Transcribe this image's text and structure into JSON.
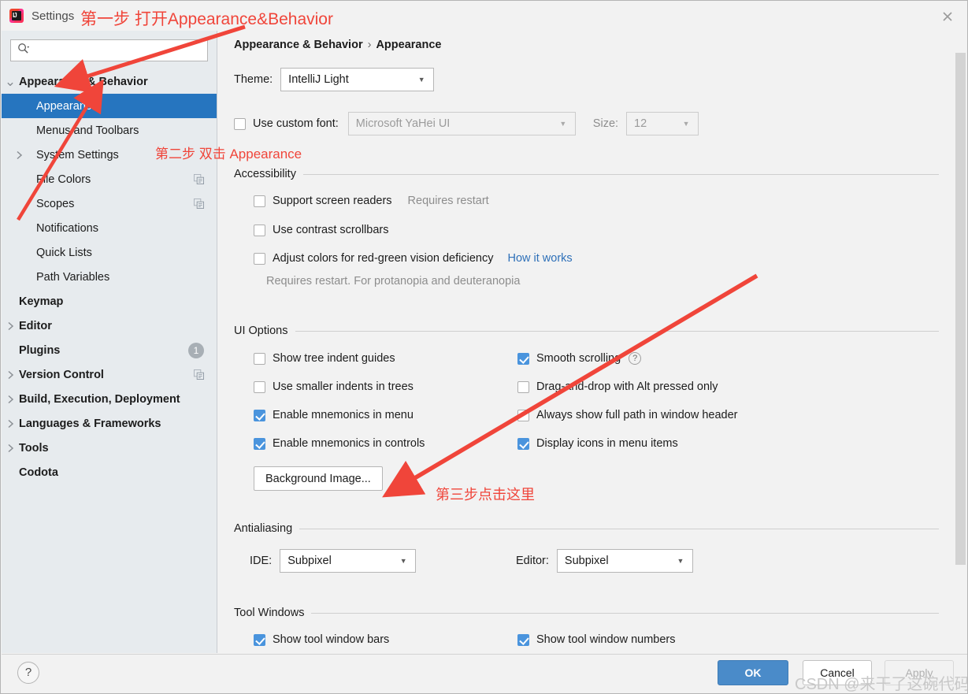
{
  "window": {
    "title": "Settings",
    "app_icon": "intellij-idea-icon",
    "close_icon": "close-icon"
  },
  "sidebar": {
    "search": {
      "placeholder": "",
      "value": "",
      "icon": "search-icon"
    },
    "items": [
      {
        "label": "Appearance & Behavior",
        "level": 0,
        "chevron": "chevron-down-icon",
        "selected": false,
        "tail": ""
      },
      {
        "label": "Appearance",
        "level": 1,
        "chevron": "",
        "selected": true,
        "tail": ""
      },
      {
        "label": "Menus and Toolbars",
        "level": 1,
        "chevron": "",
        "selected": false,
        "tail": ""
      },
      {
        "label": "System Settings",
        "level": 1,
        "chevron": "chevron-right-icon",
        "selected": false,
        "tail": ""
      },
      {
        "label": "File Colors",
        "level": 1,
        "chevron": "",
        "selected": false,
        "tail": "copy-icon"
      },
      {
        "label": "Scopes",
        "level": 1,
        "chevron": "",
        "selected": false,
        "tail": "copy-icon"
      },
      {
        "label": "Notifications",
        "level": 1,
        "chevron": "",
        "selected": false,
        "tail": ""
      },
      {
        "label": "Quick Lists",
        "level": 1,
        "chevron": "",
        "selected": false,
        "tail": ""
      },
      {
        "label": "Path Variables",
        "level": 1,
        "chevron": "",
        "selected": false,
        "tail": ""
      },
      {
        "label": "Keymap",
        "level": 0,
        "chevron": "",
        "selected": false,
        "tail": ""
      },
      {
        "label": "Editor",
        "level": 0,
        "chevron": "chevron-right-icon",
        "selected": false,
        "tail": ""
      },
      {
        "label": "Plugins",
        "level": 0,
        "chevron": "",
        "selected": false,
        "tail": "badge",
        "badge": "1"
      },
      {
        "label": "Version Control",
        "level": 0,
        "chevron": "chevron-right-icon",
        "selected": false,
        "tail": "copy-icon"
      },
      {
        "label": "Build, Execution, Deployment",
        "level": 0,
        "chevron": "chevron-right-icon",
        "selected": false,
        "tail": ""
      },
      {
        "label": "Languages & Frameworks",
        "level": 0,
        "chevron": "chevron-right-icon",
        "selected": false,
        "tail": ""
      },
      {
        "label": "Tools",
        "level": 0,
        "chevron": "chevron-right-icon",
        "selected": false,
        "tail": ""
      },
      {
        "label": "Codota",
        "level": 0,
        "chevron": "",
        "selected": false,
        "tail": ""
      }
    ]
  },
  "breadcrumb": {
    "parent": "Appearance & Behavior",
    "separator": "›",
    "current": "Appearance"
  },
  "theme": {
    "label": "Theme:",
    "value": "IntelliJ Light"
  },
  "custom_font": {
    "checkbox_label": "Use custom font:",
    "checked": false,
    "font_value": "Microsoft YaHei UI",
    "size_label": "Size:",
    "size_value": "12",
    "size_disabled": true
  },
  "accessibility": {
    "section_title": "Accessibility",
    "options": [
      {
        "label": "Support screen readers",
        "checked": false,
        "note": "Requires restart"
      },
      {
        "label": "Use contrast scrollbars",
        "checked": false,
        "note": ""
      },
      {
        "label": "Adjust colors for red-green vision deficiency",
        "checked": false,
        "link": "How it works"
      }
    ],
    "hint": "Requires restart. For protanopia and deuteranopia"
  },
  "ui_options": {
    "section_title": "UI Options",
    "left_column": [
      {
        "label": "Show tree indent guides",
        "checked": false
      },
      {
        "label": "Use smaller indents in trees",
        "checked": false
      },
      {
        "label": "Enable mnemonics in menu",
        "checked": true
      },
      {
        "label": "Enable mnemonics in controls",
        "checked": true
      }
    ],
    "right_column": [
      {
        "label": "Smooth scrolling",
        "checked": true,
        "help": "?"
      },
      {
        "label": "Drag-and-drop with Alt pressed only",
        "checked": false
      },
      {
        "label": "Always show full path in window header",
        "checked": false
      },
      {
        "label": "Display icons in menu items",
        "checked": true
      }
    ],
    "background_image_button": "Background Image..."
  },
  "antialiasing": {
    "section_title": "Antialiasing",
    "ide_label": "IDE:",
    "ide_value": "Subpixel",
    "editor_label": "Editor:",
    "editor_value": "Subpixel"
  },
  "tool_windows": {
    "section_title": "Tool Windows",
    "options": [
      {
        "label": "Show tool window bars",
        "checked": true
      },
      {
        "label": "Show tool window numbers",
        "checked": true
      }
    ]
  },
  "bottom_bar": {
    "help_icon": "?",
    "ok": "OK",
    "cancel": "Cancel",
    "apply": "Apply"
  },
  "annotations": [
    {
      "text": "第一步 打开Appearance&Behavior"
    },
    {
      "text": "第二步 双击 Appearance"
    },
    {
      "text": "第三步点击这里"
    }
  ],
  "watermark": "CSDN @来干了这碗代码",
  "colors": {
    "selection_blue": "#2675bf",
    "checkbox_blue": "#4a94dd",
    "ok_button_blue": "#4a8bc9",
    "annotation_red": "#f0453a",
    "link_blue": "#2e70b8",
    "sidebar_bg": "#e7ebee",
    "content_bg": "#f2f2f2"
  }
}
